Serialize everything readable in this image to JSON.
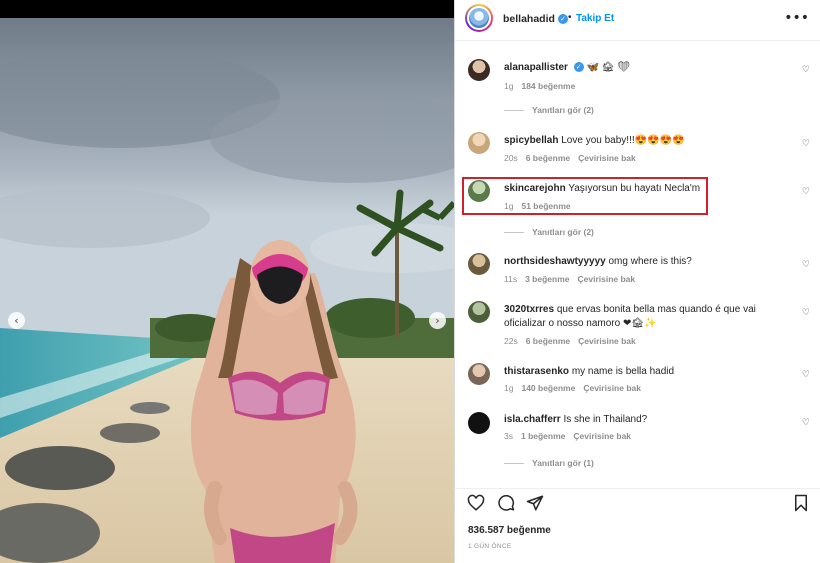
{
  "post": {
    "username": "bellahadid",
    "follow_label": "Takip Et",
    "more_label": "•••",
    "separator": "•",
    "likes": "836.587 beğenme",
    "date": "1 GÜN ÖNCE"
  },
  "carousel": {
    "prev_glyph": "‹",
    "next_glyph": "›"
  },
  "comments": [
    {
      "user": "alanapallister",
      "text": "🦋 🏚 ❤",
      "verified": true,
      "time": "1g",
      "likes": "184 beğenme",
      "translate": "",
      "replies": "Yanıtları gör (2)"
    },
    {
      "user": "spicybellah",
      "text": "Love you baby!!!😍😍😍😍",
      "time": "20s",
      "likes": "6 beğenme",
      "translate": "Çevirisine bak"
    },
    {
      "user": "skincarejohn",
      "text": "Yaşıyorsun bu hayatı Necla'm",
      "time": "1g",
      "likes": "51 beğenme",
      "translate": "",
      "replies": "Yanıtları gör (2)"
    },
    {
      "user": "northsideshawtyyyyy",
      "text": "omg where is this?",
      "time": "11s",
      "likes": "3 beğenme",
      "translate": "Çevirisine bak"
    },
    {
      "user": "3020txrres",
      "text": "que ervas bonita bella mas quando é que vai oficializar o nosso namoro ❤🏚✨",
      "time": "22s",
      "likes": "6 beğenme",
      "translate": "Çevirisine bak"
    },
    {
      "user": "thistarasenko",
      "text": "my name is bella hadid",
      "time": "1g",
      "likes": "140 beğenme",
      "translate": "Çevirisine bak"
    },
    {
      "user": "isla.chafferr",
      "text": "Is she in Thailand?",
      "time": "3s",
      "likes": "1 beğenme",
      "translate": "Çevirisine bak",
      "replies": "Yanıtları gör (1)"
    }
  ],
  "icons": {
    "heart": "♡",
    "verified": "✓"
  },
  "colors": {
    "accent": "#0095f6",
    "highlight": "#d11f2c",
    "verified": "#3897f0"
  }
}
